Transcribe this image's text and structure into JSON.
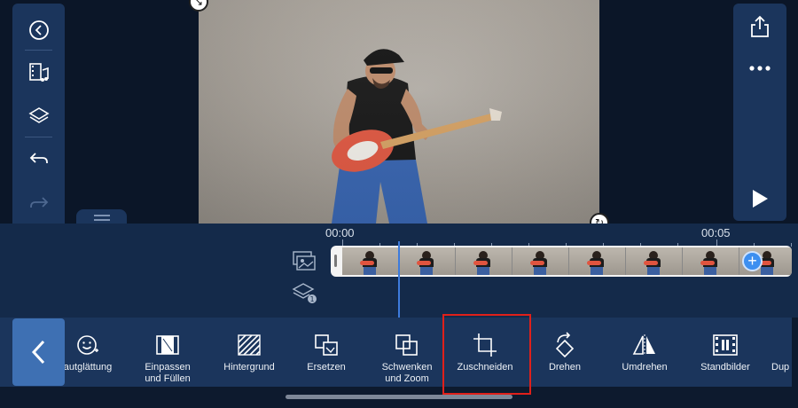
{
  "timeline": {
    "time_start": "00:00",
    "time_mark": "00:05"
  },
  "toolbar": {
    "tools": [
      {
        "label": "autglättung",
        "icon": "smile-face-icon"
      },
      {
        "label": "Einpassen\nund Füllen",
        "icon": "fit-fill-icon"
      },
      {
        "label": "Hintergrund",
        "icon": "hatched-background-icon"
      },
      {
        "label": "Ersetzen",
        "icon": "replace-icon"
      },
      {
        "label": "Schwenken\nund Zoom",
        "icon": "pan-zoom-icon"
      },
      {
        "label": "Zuschneiden",
        "icon": "crop-icon"
      },
      {
        "label": "Drehen",
        "icon": "rotate-icon"
      },
      {
        "label": "Umdrehen",
        "icon": "flip-icon"
      },
      {
        "label": "Standbilder",
        "icon": "freeze-frame-icon"
      },
      {
        "label": "Dup",
        "icon": "duplicate-icon"
      }
    ]
  },
  "colors": {
    "panel": "#1b355c",
    "accent": "#3d8ff0",
    "highlight_border": "#e0201a"
  }
}
